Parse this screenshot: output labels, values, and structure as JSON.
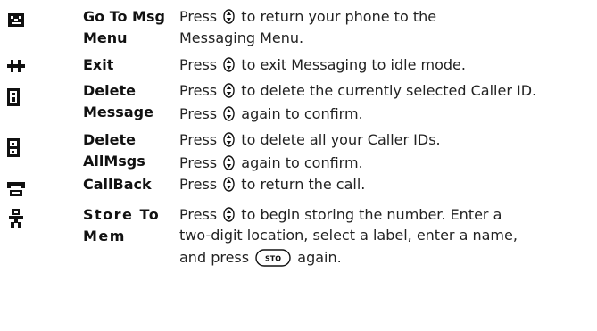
{
  "rows": [
    {
      "icon": "messaging-menu-icon",
      "label_lines": [
        "Go To Msg",
        "Menu"
      ],
      "desc_lines": [
        [
          "Press ",
          "{nav}",
          " to return your phone to the"
        ],
        [
          "Messaging Menu."
        ]
      ]
    },
    {
      "icon": "exit-icon",
      "label_lines": [
        "Exit"
      ],
      "desc_lines": [
        [
          "Press ",
          "{nav}",
          " to exit Messaging to idle mode."
        ]
      ]
    },
    {
      "icon": "delete-message-icon",
      "label_lines": [
        "Delete",
        "Message"
      ],
      "desc_lines": [
        [
          "Press ",
          "{nav}",
          " to delete the currently selected Caller ID."
        ],
        [
          "Press ",
          "{nav}",
          " again to confirm."
        ]
      ]
    },
    {
      "icon": "delete-all-icon",
      "label_lines": [
        "Delete",
        "AllMsgs"
      ],
      "desc_lines": [
        [
          "Press ",
          "{nav}",
          " to delete all your Caller IDs."
        ],
        [
          "Press ",
          "{nav}",
          " again to confirm."
        ]
      ]
    },
    {
      "icon": "phone-icon",
      "label_lines": [
        "CallBack"
      ],
      "desc_lines": [
        [
          "Press ",
          "{nav}",
          " to return the call."
        ]
      ]
    },
    {
      "icon": "store-contact-icon",
      "label_lines": [
        "Store To",
        "Mem"
      ],
      "desc_lines": [
        [
          "Press ",
          "{nav}",
          " to begin storing the number. Enter a"
        ],
        [
          "two-digit location, select a label, enter a name,"
        ],
        [
          "and press ",
          "{sto}",
          " again."
        ]
      ]
    }
  ],
  "keys": {
    "sto_label": "STO"
  }
}
